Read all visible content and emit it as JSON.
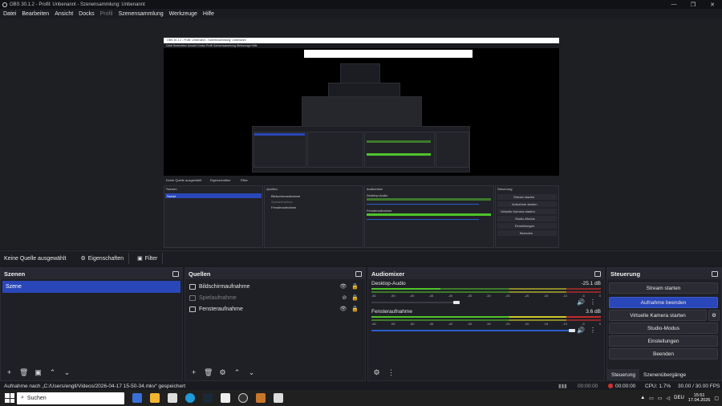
{
  "window": {
    "title": "OBS 30.1.2 - Profil: Unbenannt - Szenensammlung: Unbenannt"
  },
  "menu": [
    "Datei",
    "Bearbeiten",
    "Ansicht",
    "Docks",
    "Profil",
    "Szenensammlung",
    "Werkzeuge",
    "Hilfe"
  ],
  "source_toolbar": {
    "no_source": "Keine Quelle ausgewählt",
    "properties": "Eigenschaften",
    "filters": "Filter"
  },
  "scenes": {
    "title": "Szenen",
    "items": [
      "Szene"
    ]
  },
  "sources": {
    "title": "Quellen",
    "items": [
      {
        "name": "Bildschirmaufnahme",
        "dim": false
      },
      {
        "name": "Spielaufnahme",
        "dim": true
      },
      {
        "name": "Fensteraufnahme",
        "dim": false
      }
    ]
  },
  "mixer": {
    "title": "Audiomixer",
    "channels": [
      {
        "name": "Desktop-Audio",
        "db": "-25.1 dB",
        "level": 0.3
      },
      {
        "name": "Fensteraufnahme",
        "db": "3.6 dB",
        "level": 1.0
      }
    ],
    "ticks": [
      "-60",
      "-55",
      "-50",
      "-45",
      "-40",
      "-35",
      "-30",
      "-25",
      "-20",
      "-15",
      "-10",
      "-5",
      "0"
    ]
  },
  "controls": {
    "title": "Steuerung",
    "buttons": [
      "Stream starten",
      "Aufnahme beenden",
      "Virtuelle Kamera starten",
      "Studio-Modus",
      "Einstellungen",
      "Beenden"
    ],
    "tabs": [
      "Steuerung",
      "Szenenübergänge"
    ]
  },
  "status": {
    "message": "Aufnahme nach „C:/Users/engll/Videos/2026-04-17 15-50-34.mkv“ gespeichert",
    "rec_time": "00:00:00",
    "rec_time2": "00:00:00",
    "cpu": "CPU: 1.7%",
    "fps": "30.00 / 30.00 FPS"
  },
  "taskbar": {
    "search": "Suchen",
    "lang": "DEU",
    "time": "15:51",
    "date": "17.04.2026"
  },
  "preview_text": {
    "title": "OBS 30.1.2 - Profil: Unbenannt - Szenensammlung: Unbenannt",
    "menu": "Datei  Bearbeiten  Ansicht  Docks  Profil  Szenensammlung  Werkzeuge  Hilfe",
    "no_source": "Keine Quelle ausgewählt",
    "props": "Eigenschaften",
    "filter": "Filter",
    "scenes": "Szenen",
    "sources": "Quellen",
    "mixer": "Audiomixer",
    "controls": "Steuerung",
    "scene_item": "Szene",
    "src1": "Bildschirmaufnahme",
    "src2": "Spielaufnahme",
    "src3": "Fensteraufnahme",
    "desk": "Desktop-Audio",
    "win": "Fensteraufnahme",
    "b1": "Stream starten",
    "b2": "Aufnahme starten",
    "b3": "Virtuelle Kamera starten",
    "b4": "Studio-Modus",
    "b5": "Einstellungen",
    "b6": "Beenden",
    "status": "Aufnahme nach „C:/Users/engll/Videos/2026-04-17 15-50-34.mkv“ gespeichert",
    "search": "Suchen"
  },
  "colors": {
    "accent": "#2947b8",
    "bg": "#1a1b20"
  }
}
